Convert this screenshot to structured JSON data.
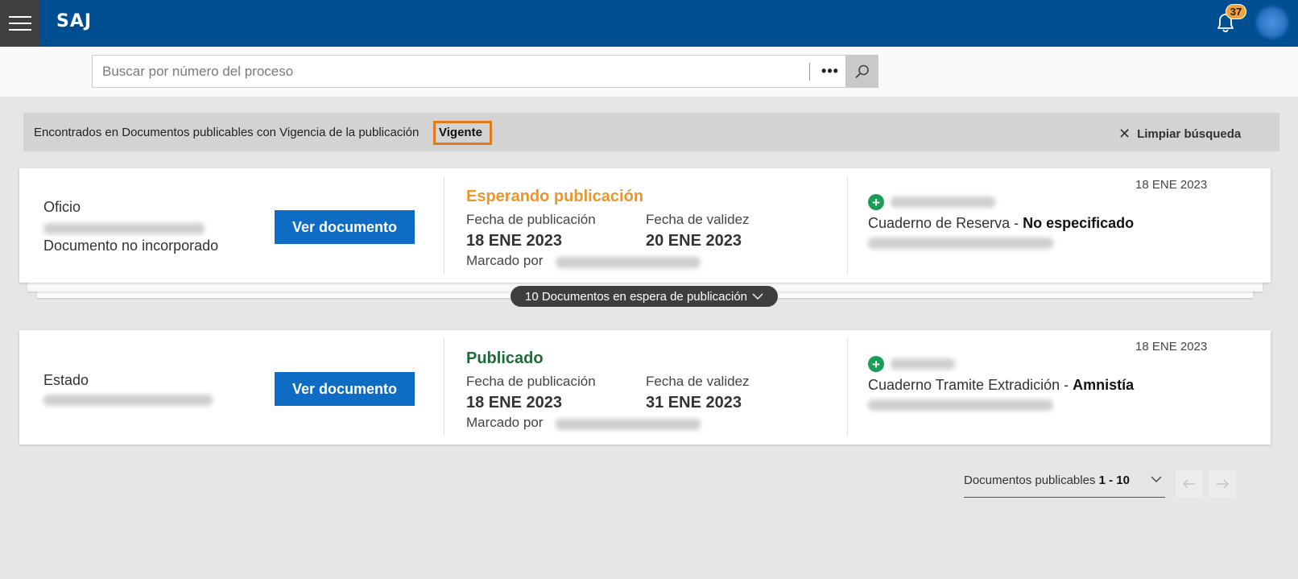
{
  "header": {
    "logo": "SAJ",
    "notifications_count": "37"
  },
  "search": {
    "placeholder": "Buscar por número del proceso",
    "more_label": "•••"
  },
  "filter": {
    "text": "Encontrados en Documentos publicables con Vigencia de la publicación",
    "highlight": "Vigente",
    "clear_label": "Limpiar búsqueda"
  },
  "cards": [
    {
      "doc_type": "Oficio",
      "doc_status": "Documento no incorporado",
      "button_label": "Ver documento",
      "pub_status": "Esperando publicación",
      "pub_status_color": "#e8962e",
      "pub_date_label": "Fecha de publicación",
      "pub_date": "18 ENE 2023",
      "validity_label": "Fecha de validez",
      "validity_date": "20 ENE 2023",
      "marked_by_label": "Marcado por",
      "date": "18 ENE 2023",
      "cuaderno_prefix": "Cuaderno de Reserva - ",
      "cuaderno_value": "No especificado"
    },
    {
      "doc_type": "Estado",
      "doc_status": "",
      "button_label": "Ver documento",
      "pub_status": "Publicado",
      "pub_status_color": "#1e6b3a",
      "pub_date_label": "Fecha de publicación",
      "pub_date": "18 ENE 2023",
      "validity_label": "Fecha de validez",
      "validity_date": "31 ENE 2023",
      "marked_by_label": "Marcado por",
      "date": "18 ENE 2023",
      "cuaderno_prefix": "Cuaderno Tramite Extradición - ",
      "cuaderno_value": "Amnistía"
    }
  ],
  "pending": {
    "label": "10 Documentos en espera de publicación"
  },
  "pagination": {
    "label": "Documentos publicables",
    "range": "1 - 10"
  }
}
